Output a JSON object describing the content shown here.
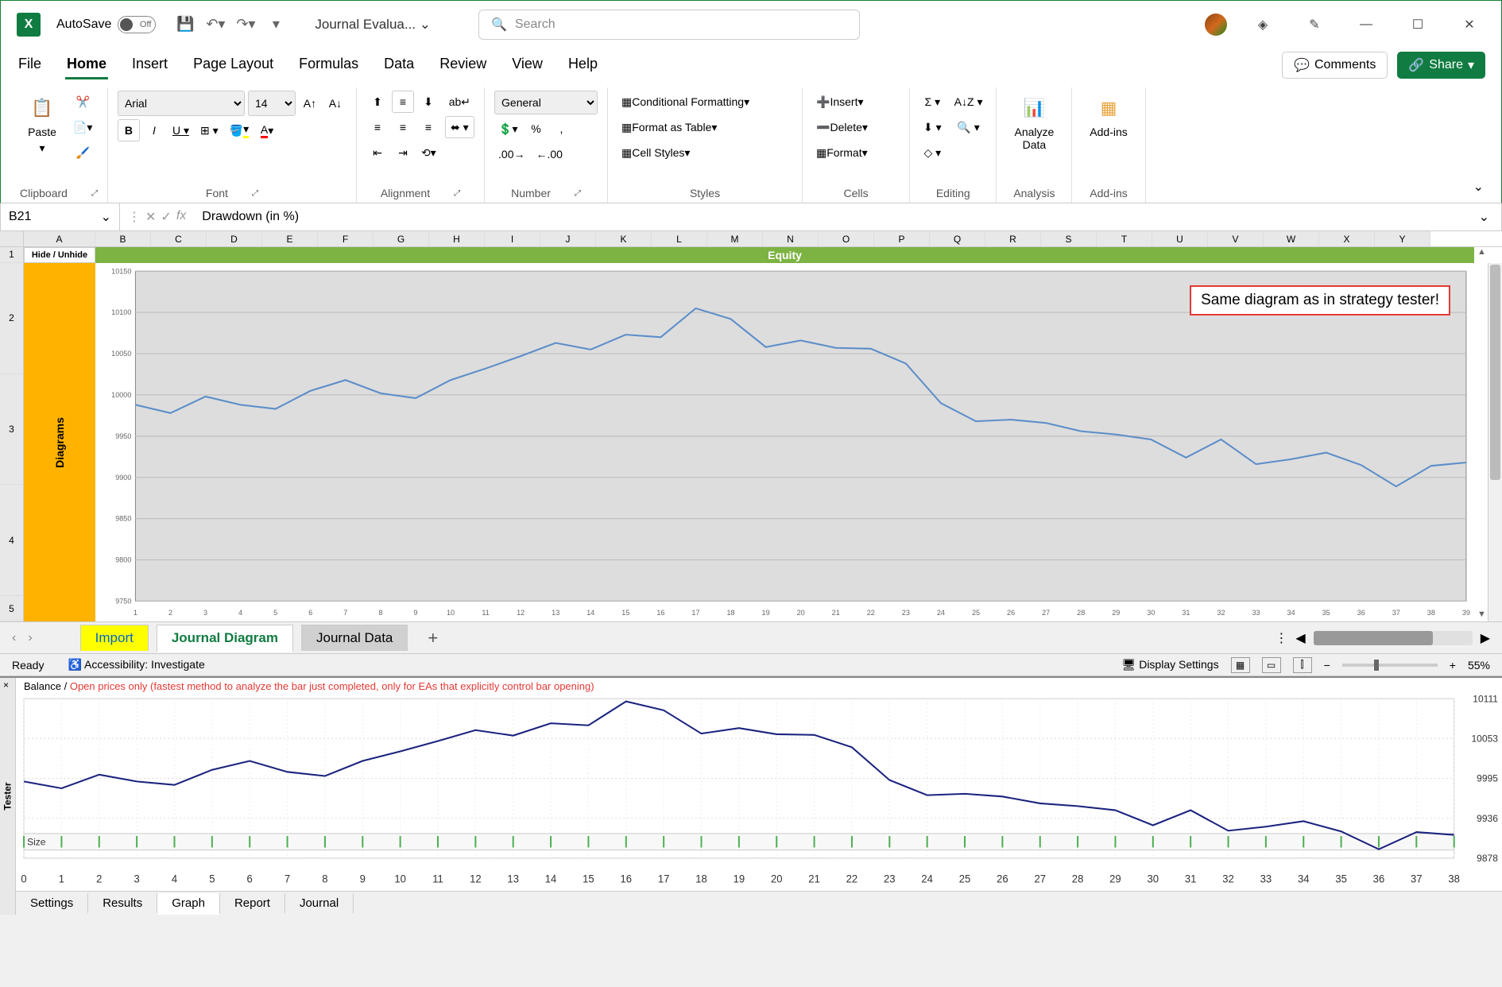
{
  "title": {
    "autosave_label": "AutoSave",
    "autosave_state": "Off",
    "doc_name": "Journal Evalua...",
    "search_placeholder": "Search"
  },
  "ribbon_tabs": [
    "File",
    "Home",
    "Insert",
    "Page Layout",
    "Formulas",
    "Data",
    "Review",
    "View",
    "Help"
  ],
  "ribbon_active": "Home",
  "ribbon_right": {
    "comments": "Comments",
    "share": "Share"
  },
  "ribbon": {
    "clipboard": {
      "paste": "Paste",
      "label": "Clipboard"
    },
    "font": {
      "name": "Arial",
      "size": "14",
      "label": "Font"
    },
    "alignment": {
      "label": "Alignment"
    },
    "number": {
      "format": "General",
      "label": "Number"
    },
    "styles": {
      "cond_fmt": "Conditional Formatting",
      "fmt_table": "Format as Table",
      "cell_styles": "Cell Styles",
      "label": "Styles"
    },
    "cells": {
      "insert": "Insert",
      "delete": "Delete",
      "format": "Format",
      "label": "Cells"
    },
    "editing": {
      "label": "Editing"
    },
    "analysis": {
      "analyze": "Analyze\nData",
      "label": "Analysis"
    },
    "addins": {
      "addins": "Add-ins",
      "label": "Add-ins"
    }
  },
  "formula_bar": {
    "name_box": "B21",
    "formula": "Drawdown (in %)"
  },
  "columns": [
    "A",
    "B",
    "C",
    "D",
    "E",
    "F",
    "G",
    "H",
    "I",
    "J",
    "K",
    "L",
    "M",
    "N",
    "O",
    "P",
    "Q",
    "R",
    "S",
    "T",
    "U",
    "V",
    "W",
    "X",
    "Y"
  ],
  "rows": [
    "1",
    "2",
    "3",
    "4",
    "5"
  ],
  "grid": {
    "hide_label": "Hide / Unhide",
    "equity_label": "Equity",
    "diagrams_label": "Diagrams",
    "annotation": "Same diagram as in strategy tester!"
  },
  "sheet_tabs": {
    "import": "Import",
    "journal_diagram": "Journal Diagram",
    "journal_data": "Journal Data"
  },
  "status": {
    "ready": "Ready",
    "accessibility": "Accessibility: Investigate",
    "display_settings": "Display Settings",
    "zoom": "55%"
  },
  "tester": {
    "side_label": "Tester",
    "balance_label": "Balance /",
    "balance_note": "Open prices only (fastest method to analyze the bar just completed, only for EAs that explicitly control bar opening)",
    "size_label": "Size",
    "tabs": [
      "Settings",
      "Results",
      "Graph",
      "Report",
      "Journal"
    ],
    "active_tab": "Graph",
    "y_labels": [
      "10111",
      "10053",
      "9995",
      "9936",
      "9878"
    ]
  },
  "chart_data": {
    "type": "line",
    "title": "Equity",
    "xlabel": "",
    "ylabel": "",
    "ylim": [
      9750,
      10150
    ],
    "y_ticks": [
      9750,
      9800,
      9850,
      9900,
      9950,
      10000,
      10050,
      10100,
      10150
    ],
    "x": [
      1,
      2,
      3,
      4,
      5,
      6,
      7,
      8,
      9,
      10,
      11,
      12,
      13,
      14,
      15,
      16,
      17,
      18,
      19,
      20,
      21,
      22,
      23,
      24,
      25,
      26,
      27,
      28,
      29,
      30,
      31,
      32,
      33,
      34,
      35,
      36,
      37,
      38,
      39
    ],
    "values": [
      9988,
      9978,
      9998,
      9988,
      9983,
      10005,
      10018,
      10002,
      9996,
      10018,
      10032,
      10047,
      10063,
      10055,
      10073,
      10070,
      10105,
      10092,
      10058,
      10066,
      10057,
      10056,
      10038,
      9990,
      9968,
      9970,
      9966,
      9956,
      9952,
      9946,
      9924,
      9946,
      9916,
      9922,
      9930,
      9915,
      9889,
      9914,
      9918
    ],
    "series_name": "Equity",
    "annotation": "Same diagram as in strategy tester!"
  },
  "tester_chart_data": {
    "type": "line",
    "ylim": [
      9878,
      10111
    ],
    "x": [
      0,
      1,
      2,
      3,
      4,
      5,
      6,
      7,
      8,
      9,
      10,
      11,
      12,
      13,
      14,
      15,
      16,
      17,
      18,
      19,
      20,
      21,
      22,
      23,
      24,
      25,
      26,
      27,
      28,
      29,
      30,
      31,
      32,
      33,
      34,
      35,
      36,
      37,
      38
    ],
    "values": [
      9990,
      9980,
      10000,
      9990,
      9985,
      10007,
      10020,
      10004,
      9998,
      10020,
      10034,
      10049,
      10065,
      10057,
      10075,
      10072,
      10107,
      10094,
      10060,
      10068,
      10059,
      10058,
      10040,
      9992,
      9970,
      9972,
      9968,
      9958,
      9954,
      9948,
      9926,
      9948,
      9918,
      9924,
      9932,
      9917,
      9891,
      9916,
      9912
    ]
  }
}
